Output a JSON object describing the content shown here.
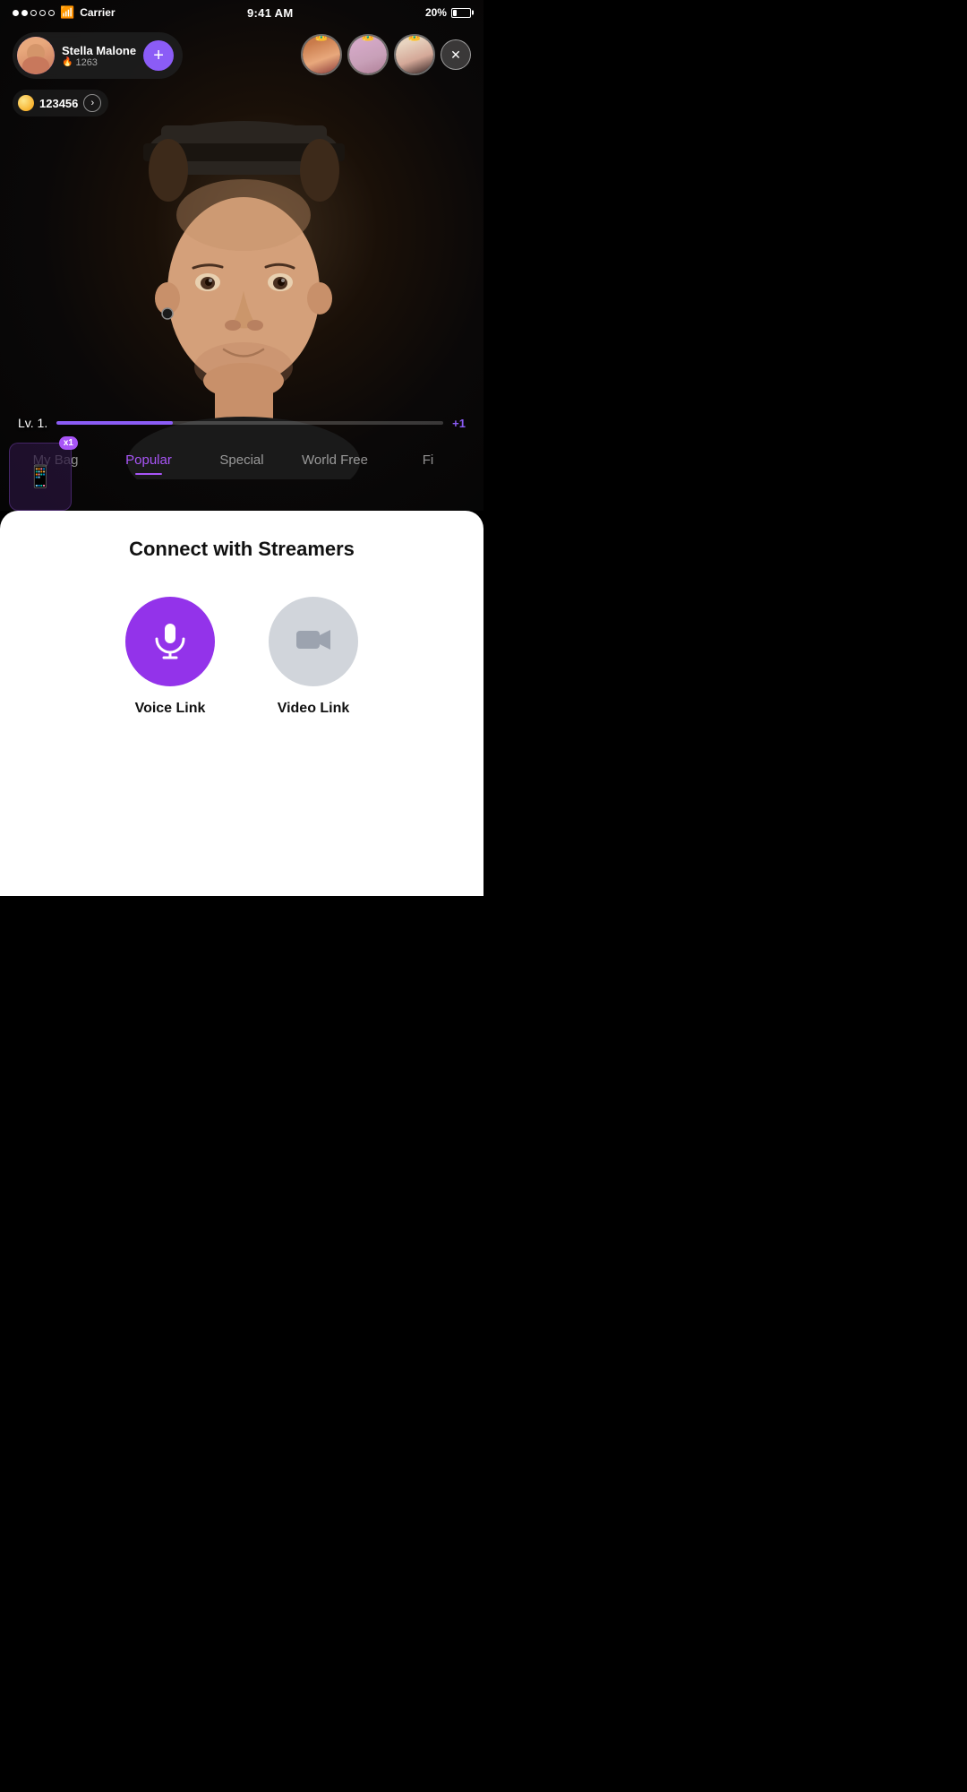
{
  "statusBar": {
    "carrier": "Carrier",
    "signal": [
      "filled",
      "filled",
      "empty",
      "empty",
      "empty"
    ],
    "wifi": true,
    "time": "9:41 AM",
    "battery": "20%"
  },
  "userCard": {
    "name": "Stella Malone",
    "level": "1263",
    "coins": "123456",
    "addButton": "+"
  },
  "audience": {
    "closeButton": "✕"
  },
  "levelBar": {
    "label": "Lv. 1.",
    "percent": 30,
    "plus": "+1"
  },
  "categoryTabs": [
    {
      "id": "my-bag",
      "label": "My Bag",
      "active": false
    },
    {
      "id": "popular",
      "label": "Popular",
      "active": true
    },
    {
      "id": "special",
      "label": "Special",
      "active": false
    },
    {
      "id": "world-free",
      "label": "World Free",
      "active": false
    },
    {
      "id": "fi",
      "label": "Fi",
      "active": false
    }
  ],
  "gifts": [
    {
      "emoji": "📱",
      "badge": "x1"
    }
  ],
  "bottomPanel": {
    "title": "Connect with Streamers",
    "voiceLink": "Voice Link",
    "videoLink": "Video Link"
  }
}
